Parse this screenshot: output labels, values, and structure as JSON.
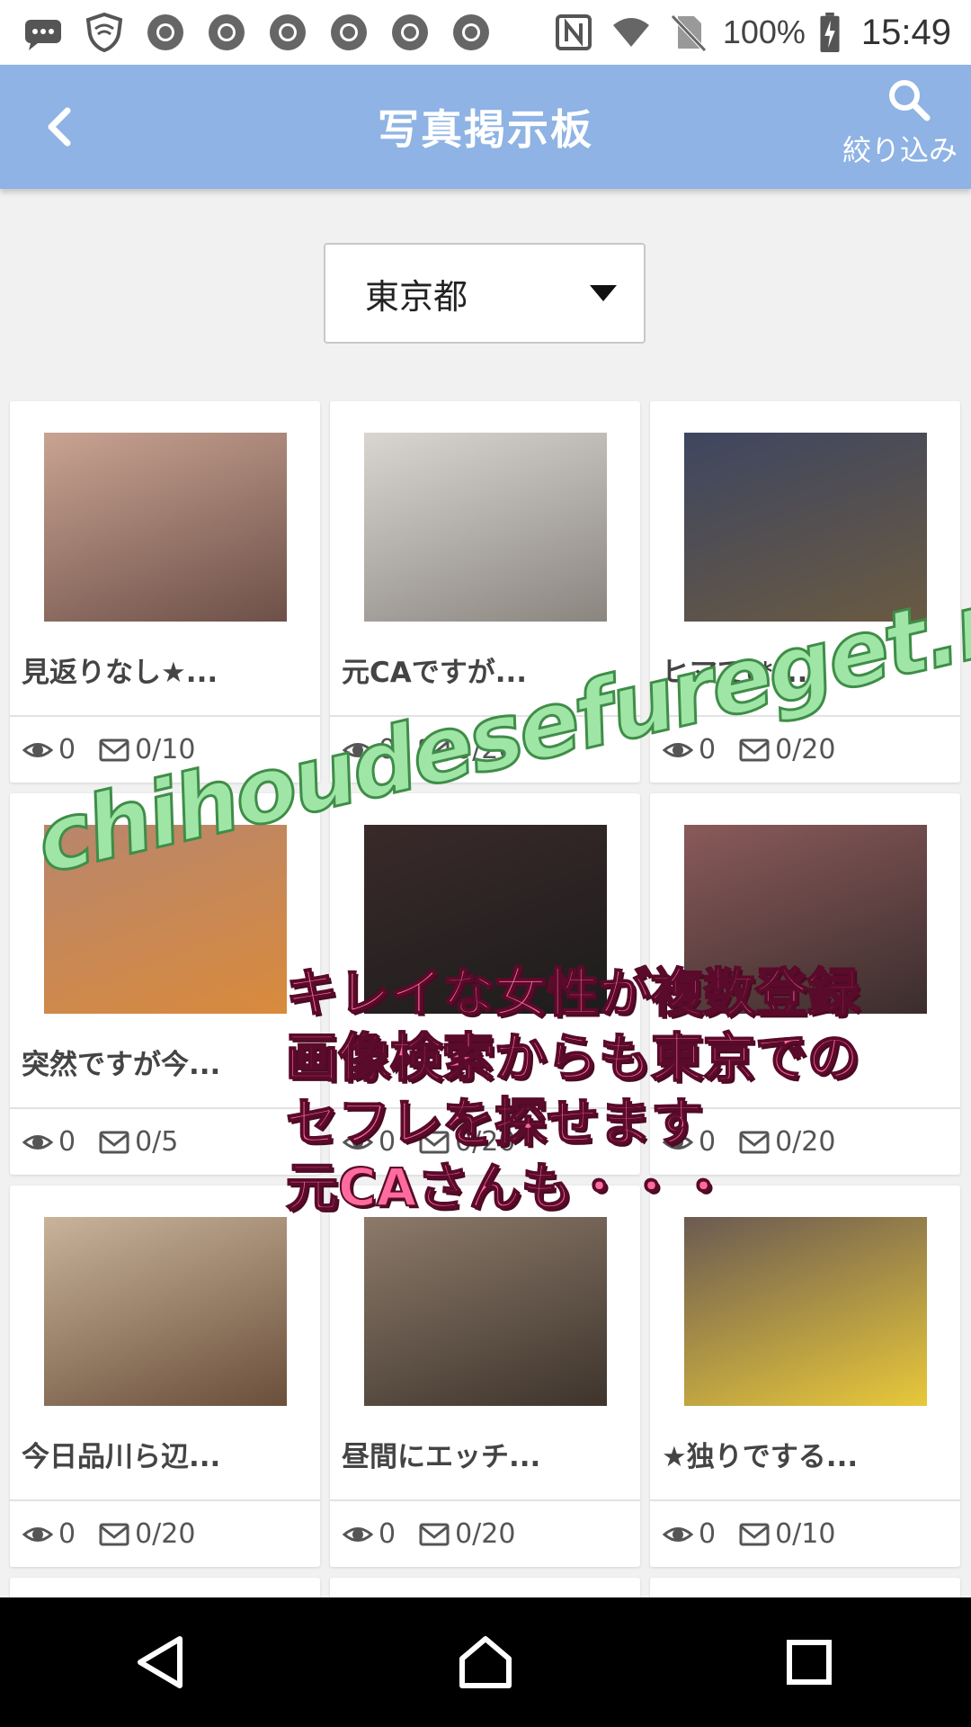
{
  "status_bar": {
    "battery_text": "100%",
    "time": "15:49",
    "icons": [
      "message-icon",
      "shield-icon",
      "chrome-icon",
      "chrome-icon",
      "chrome-icon",
      "chrome-icon",
      "chrome-icon",
      "chrome-icon",
      "nfc-icon",
      "wifi-icon",
      "no-sim-icon",
      "battery-charging-icon"
    ]
  },
  "header": {
    "title": "写真掲示板",
    "filter_label": "絞り込み"
  },
  "region": {
    "selected": "東京都"
  },
  "posts": [
    {
      "title": "見返りなし★...",
      "views": "0",
      "messages": "0/10",
      "thumb_colors": [
        "#c9a392",
        "#6d5048"
      ]
    },
    {
      "title": "元CAですが...",
      "views": "0",
      "messages": "0/20",
      "thumb_colors": [
        "#d9d6d2",
        "#8a857f"
      ]
    },
    {
      "title": "ヒマで(*´...",
      "views": "0",
      "messages": "0/20",
      "thumb_colors": [
        "#3e4660",
        "#6a5a42"
      ]
    },
    {
      "title": "突然ですが今...",
      "views": "0",
      "messages": "0/5",
      "thumb_colors": [
        "#b8866d",
        "#d98a3c"
      ]
    },
    {
      "title": "",
      "views": "0",
      "messages": "0/20",
      "thumb_colors": [
        "#3a2a2a",
        "#1c1c1c"
      ]
    },
    {
      "title": "",
      "views": "0",
      "messages": "0/20",
      "thumb_colors": [
        "#8a5a5a",
        "#3b2d2d"
      ]
    },
    {
      "title": "今日品川ら辺...",
      "views": "0",
      "messages": "0/20",
      "thumb_colors": [
        "#c9b39a",
        "#6a4f3a"
      ]
    },
    {
      "title": "昼間にエッチ...",
      "views": "0",
      "messages": "0/20",
      "thumb_colors": [
        "#8c7a6a",
        "#3e342c"
      ]
    },
    {
      "title": "★独りでする...",
      "views": "0",
      "messages": "0/10",
      "thumb_colors": [
        "#6b5a52",
        "#e8c83a"
      ]
    }
  ],
  "overlay": {
    "watermark": "chihoudesefureget.net",
    "promo_lines": [
      "キレイな女性が複数登録",
      "画像検索からも東京での",
      "セフレを探せます",
      "元CAさんも・・・"
    ]
  },
  "colors": {
    "app_bar": "#8eb3e4",
    "watermark_fill": "#9fe6a6",
    "promo_fill": "#ff6b9c"
  }
}
